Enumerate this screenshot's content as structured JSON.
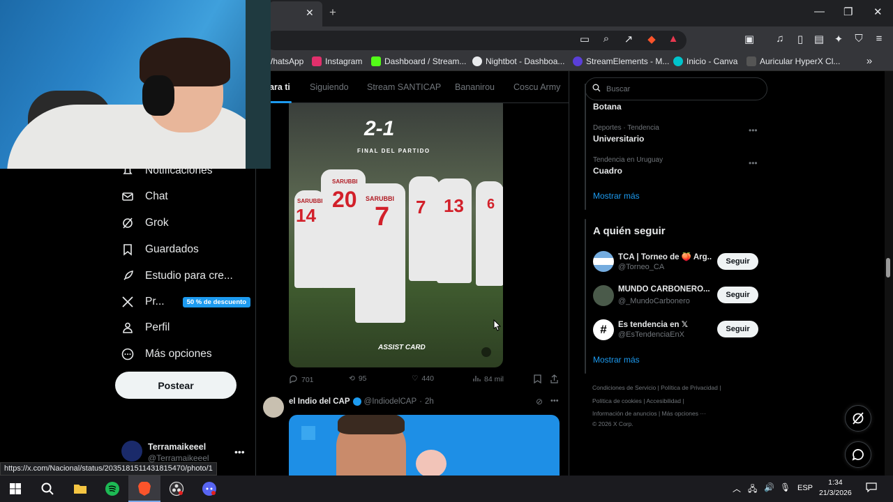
{
  "browser": {
    "window_controls": {
      "minimize": "✕",
      "maximize": "☐",
      "close": "✕"
    },
    "bookmarks": [
      {
        "label": "WhatsApp",
        "color": "#25d366"
      },
      {
        "label": "Instagram",
        "color": "#e1306c"
      },
      {
        "label": "Dashboard / Stream...",
        "color": "#53fc18"
      },
      {
        "label": "Nightbot - Dashboa...",
        "color": "#e8eaed"
      },
      {
        "label": "StreamElements - M...",
        "color": "#5a3fd8"
      },
      {
        "label": "Inicio - Canva",
        "color": "#00c4cc"
      },
      {
        "label": "Auricular HyperX Cl...",
        "color": "#444"
      }
    ],
    "status_url": "https://x.com/Nacional/status/2035181511431815470/photo/1"
  },
  "sidebar": {
    "items": [
      {
        "label": "Notificaciones",
        "icon": "bell-icon"
      },
      {
        "label": "Chat",
        "icon": "mail-icon"
      },
      {
        "label": "Grok",
        "icon": "grok-icon"
      },
      {
        "label": "Guardados",
        "icon": "bookmark-icon"
      },
      {
        "label": "Estudio para cre...",
        "icon": "rocket-icon"
      },
      {
        "label": "Pr...",
        "icon": "x-logo-icon",
        "badge": "50 % de descuento"
      },
      {
        "label": "Perfil",
        "icon": "person-icon"
      },
      {
        "label": "Más opciones",
        "icon": "more-circle-icon"
      }
    ],
    "post_button": "Postear",
    "account": {
      "name": "Terramaikeeel",
      "handle": "@Terramaikeeel"
    }
  },
  "timeline": {
    "tabs": [
      "ara ti",
      "Siguiendo",
      "Stream SANTICAP",
      "Bananirou",
      "Coscu Army"
    ],
    "post1": {
      "image_score": "2-1",
      "image_caption": "FINAL DEL PARTIDO",
      "image_sponsor": "ASSIST CARD",
      "player_names": [
        "SARUBBI",
        "SARUBBI",
        "SARUBBI"
      ],
      "player_numbers": [
        "14",
        "20",
        "7",
        "7",
        "13",
        "6"
      ],
      "replies": "701",
      "reposts": "95",
      "likes": "440",
      "views": "84 mil"
    },
    "post2": {
      "name": "el Indio del CAP",
      "handle": "@IndiodelCAP",
      "time": "2h"
    }
  },
  "right": {
    "search_placeholder": "Buscar",
    "trends": [
      {
        "meta": "",
        "name": "Botana"
      },
      {
        "meta": "Deportes · Tendencia",
        "name": "Universitario"
      },
      {
        "meta": "Tendencia en Uruguay",
        "name": "Cuadro"
      }
    ],
    "show_more": "Mostrar más",
    "follow_title": "A quién seguir",
    "follow": [
      {
        "name": "TCA | Torneo de 🍑 Arg...",
        "handle": "@Torneo_CA",
        "button": "Seguir"
      },
      {
        "name": "MUNDO CARBONERO...",
        "handle": "@_MundoCarbonero",
        "button": "Seguir"
      },
      {
        "name": "Es tendencia en 𝕏",
        "handle": "@EsTendenciaEnX",
        "button": "Seguir"
      }
    ],
    "footer": [
      "Condiciones de Servicio  |  Política de Privacidad  |",
      "Política de cookies  |  Accesibilidad  |",
      "Información de anuncios  |  Más opciones ···",
      "© 2026 X Corp."
    ]
  },
  "taskbar": {
    "language": "ESP",
    "time": "1:34",
    "date": "21/3/2026"
  }
}
